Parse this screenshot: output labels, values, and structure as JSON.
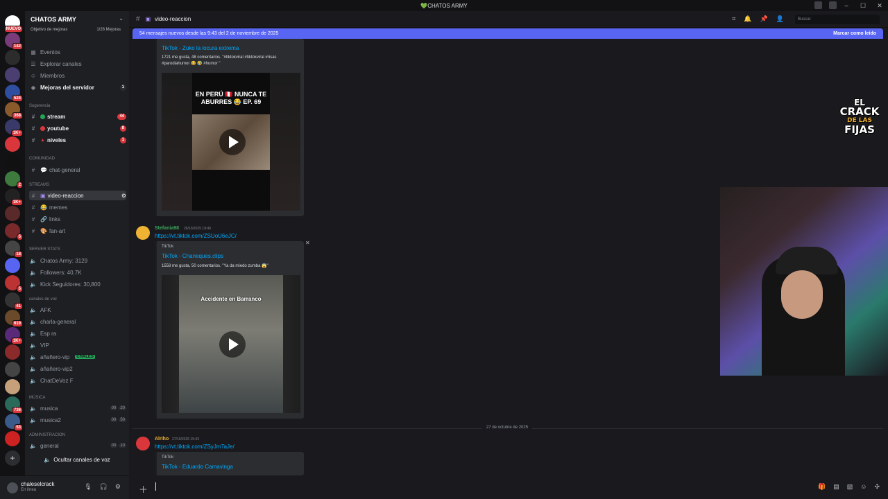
{
  "window": {
    "title": "💚CHATOS ARMY",
    "controls": [
      "–",
      "☐",
      "✕"
    ]
  },
  "guilds": [
    {
      "badge": "NUEVO"
    },
    {
      "badge": "142"
    },
    {
      "badge": ""
    },
    {
      "badge": ""
    },
    {
      "badge": "524"
    },
    {
      "badge": "368"
    },
    {
      "badge": "1K+"
    },
    {
      "badge": ""
    },
    {
      "badge": ""
    },
    {
      "badge": "2"
    },
    {
      "badge": "1K+"
    },
    {
      "badge": ""
    },
    {
      "badge": "5"
    },
    {
      "badge": "18"
    },
    {
      "badge": ""
    },
    {
      "badge": "5"
    },
    {
      "badge": "41"
    },
    {
      "badge": "619"
    },
    {
      "badge": "1K+"
    },
    {
      "badge": ""
    },
    {
      "badge": ""
    },
    {
      "badge": ""
    },
    {
      "badge": "736"
    },
    {
      "badge": "53"
    },
    {
      "badge": ""
    }
  ],
  "server": {
    "name": "CHATOS ARMY",
    "boost_label": "Objetivo de mejoras",
    "boost_count": "1/28 Mejoras",
    "chevron": "⌄"
  },
  "sidebar": {
    "top_items": [
      {
        "label": "Eventos",
        "icon": "calendar-icon",
        "glyph": "▦"
      },
      {
        "label": "Explorar canales",
        "icon": "browse-icon",
        "glyph": "☰"
      },
      {
        "label": "Miembros",
        "icon": "members-icon",
        "glyph": "☺"
      },
      {
        "label": "Mejoras del servidor",
        "icon": "boost-icon",
        "glyph": "◆",
        "count": "1"
      }
    ],
    "suggestion_label": "Sugerencia",
    "suggested": [
      {
        "label": "stream",
        "count": "44",
        "color": "#23a55a"
      },
      {
        "label": "youtube",
        "count": "8",
        "color": "#da373c"
      },
      {
        "label": "niveles",
        "count": "1",
        "color": "#da373c"
      }
    ],
    "cat_comunidad": "COMUNIDAD",
    "chat_general": "chat-general",
    "cat_streams": "STREAMS",
    "streams": [
      "video-reaccion",
      "memes",
      "links",
      "fan-art"
    ],
    "cat_server_stats": "SERVER STATS",
    "stats": [
      "Chatos Army: 3129",
      "Followers: 40.7K",
      "Kick Seguidores: 30,800"
    ],
    "cat_voz": "canales de voz",
    "voice": [
      "AFK",
      "charla-general",
      "Esp  ra",
      "VIP",
      "añañero-vip",
      "añañero-vip2",
      "ChatDeVoz F"
    ],
    "chales_tag": "CHALES",
    "cat_musica": "MÚSICA",
    "music": [
      {
        "label": "musica",
        "a": "00",
        "b": "20"
      },
      {
        "label": "musica2",
        "a": "00",
        "b": "50"
      }
    ],
    "cat_admin": "ADMINISTRACION",
    "admin": [
      {
        "label": "general",
        "a": "00",
        "b": "10"
      }
    ],
    "hide_voice": "Ocultar canales de voz"
  },
  "user": {
    "name": "chaleselcrack",
    "status": "En línea"
  },
  "channel": {
    "name": "video-reaccion",
    "search_placeholder": "Buscar"
  },
  "banner": {
    "text": "54 mensajes nuevos desde las 9:43 del 2 de noviembre de 2025",
    "action": "Marcar como leído"
  },
  "messages": [
    {
      "embed_title": "TikTok - Zuko la locura extrema",
      "embed_desc": "1721 me gusta, 48 comentarios. \"#tiktokviral #tiktokviral #risas #parodiahumor 😂 🤣 #humor \"",
      "video_caption": "EN PERÚ 🇵🇪 NUNCA TE ABURRES 😂 EP. 69"
    },
    {
      "author": "Stefania98",
      "time": "26/10/2025 19:49",
      "link": "https://vt.tiktok.com/ZSUoU6eJC/",
      "provider": "TikTok",
      "embed_title": "TikTok - Chaneques.clips",
      "embed_desc": "1558 me gusta, 50 comentarios. \"Ya da miedo zumba 😱\"",
      "video_caption": "Accidente en Barranco"
    },
    {
      "author": "Alriho",
      "time": "27/10/2025 15:43",
      "link": "https://vt.tiktok.com/ZSyJmTaJe/",
      "provider": "TikTok",
      "embed_title": "TikTok - Eduardo Camavinga"
    }
  ],
  "date_divider": "27 de octubre de 2025",
  "overlay_logo": [
    "EL",
    "CRACK",
    "DE LAS",
    "FIJAS"
  ],
  "colors": {
    "accent": "#5865f2",
    "link": "#00a8fc",
    "mention_badge": "#da373c",
    "stefania_name": "#3ba55c",
    "alriho_name": "#f0b232"
  }
}
